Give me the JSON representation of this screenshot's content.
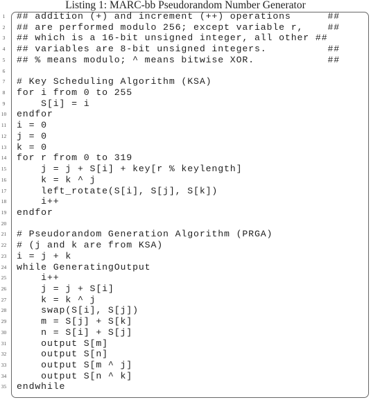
{
  "caption": "Listing 1: MARC-bb Pseudorandom Number Generator",
  "lines": [
    {
      "n": "1",
      "code": "## addition (+) and increment (++) operations      ##"
    },
    {
      "n": "2",
      "code": "## are performed modulo 256; except variable r,    ##"
    },
    {
      "n": "3",
      "code": "## which is a 16-bit unsigned integer, all other ##"
    },
    {
      "n": "4",
      "code": "## variables are 8-bit unsigned integers.          ##"
    },
    {
      "n": "5",
      "code": "## % means modulo; ^ means bitwise XOR.            ##"
    },
    {
      "n": "6",
      "code": ""
    },
    {
      "n": "7",
      "code": "# Key Scheduling Algorithm (KSA)"
    },
    {
      "n": "8",
      "code": "for i from 0 to 255"
    },
    {
      "n": "9",
      "code": "    S[i] = i"
    },
    {
      "n": "10",
      "code": "endfor"
    },
    {
      "n": "11",
      "code": "i = 0"
    },
    {
      "n": "12",
      "code": "j = 0"
    },
    {
      "n": "13",
      "code": "k = 0"
    },
    {
      "n": "14",
      "code": "for r from 0 to 319"
    },
    {
      "n": "15",
      "code": "    j = j + S[i] + key[r % keylength]"
    },
    {
      "n": "16",
      "code": "    k = k ^ j"
    },
    {
      "n": "17",
      "code": "    left_rotate(S[i], S[j], S[k])"
    },
    {
      "n": "18",
      "code": "    i++"
    },
    {
      "n": "19",
      "code": "endfor"
    },
    {
      "n": "20",
      "code": ""
    },
    {
      "n": "21",
      "code": "# Pseudorandom Generation Algorithm (PRGA)"
    },
    {
      "n": "22",
      "code": "# (j and k are from KSA)"
    },
    {
      "n": "23",
      "code": "i = j + k"
    },
    {
      "n": "24",
      "code": "while GeneratingOutput"
    },
    {
      "n": "25",
      "code": "    i++"
    },
    {
      "n": "26",
      "code": "    j = j + S[i]"
    },
    {
      "n": "27",
      "code": "    k = k ^ j"
    },
    {
      "n": "28",
      "code": "    swap(S[i], S[j])"
    },
    {
      "n": "29",
      "code": "    m = S[j] + S[k]"
    },
    {
      "n": "30",
      "code": "    n = S[i] + S[j]"
    },
    {
      "n": "31",
      "code": "    output S[m]"
    },
    {
      "n": "32",
      "code": "    output S[n]"
    },
    {
      "n": "33",
      "code": "    output S[m ^ j]"
    },
    {
      "n": "34",
      "code": "    output S[n ^ k]"
    },
    {
      "n": "35",
      "code": "endwhile"
    }
  ]
}
